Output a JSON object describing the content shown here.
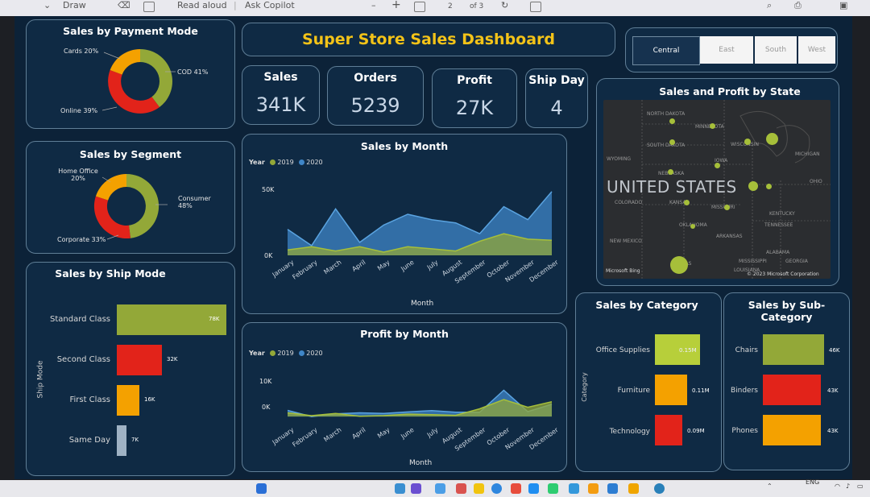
{
  "browser": {
    "draw_label": "Draw",
    "read_aloud_label": "Read aloud",
    "ask_copilot_label": "Ask Copilot",
    "page_current": "2",
    "page_of": "of 3"
  },
  "dashboard": {
    "title": "Super Store Sales Dashboard",
    "slicer": [
      "Central",
      "East",
      "South",
      "West"
    ],
    "kpis": [
      {
        "label": "Sales",
        "value": "341K"
      },
      {
        "label": "Orders",
        "value": "5239"
      },
      {
        "label": "Profit",
        "value": "27K"
      },
      {
        "label": "Ship Day",
        "value": "4"
      }
    ],
    "payment": {
      "title": "Sales by Payment Mode",
      "labels": [
        "Cards 20%",
        "COD 41%",
        "Online 39%"
      ]
    },
    "segment": {
      "title": "Sales by Segment",
      "labels": [
        "Home Office 20%",
        "Consumer 48%",
        "Corporate 33%"
      ]
    },
    "ship_mode": {
      "title": "Sales by Ship Mode",
      "axis": "Ship Mode",
      "items": [
        {
          "label": "Standard Class",
          "value": "78K"
        },
        {
          "label": "Second Class",
          "value": "32K"
        },
        {
          "label": "First Class",
          "value": "16K"
        },
        {
          "label": "Same Day",
          "value": "7K"
        }
      ]
    },
    "sales_month": {
      "title": "Sales by Month",
      "legend_title": "Year",
      "ytick_top": "50K",
      "ytick_bottom": "0K",
      "xlabel": "Month"
    },
    "profit_month": {
      "title": "Profit by Month",
      "legend_title": "Year",
      "ytick_top": "10K",
      "ytick_bottom": "0K",
      "xlabel": "Month"
    },
    "months": [
      "January",
      "February",
      "March",
      "April",
      "May",
      "June",
      "July",
      "August",
      "September",
      "October",
      "November",
      "December"
    ],
    "years": [
      "2019",
      "2020"
    ],
    "map": {
      "title": "Sales and Profit by State",
      "country_label": "UNITED STATES",
      "states": [
        "NORTH DAKOTA",
        "MINNESOTA",
        "WISCONSIN",
        "SOUTH DAKOTA",
        "MICHIGAN",
        "WYOMING",
        "IOWA",
        "NEBRASKA",
        "OHIO",
        "COLORADO",
        "KANSAS",
        "MISSOURI",
        "KENTUCKY",
        "OKLAHOMA",
        "TENNESSEE",
        "NEW MEXICO",
        "ARKANSAS",
        "ALABAMA",
        "TEXAS",
        "MISSISSIPPI",
        "GEORGIA",
        "LOUISIANA"
      ],
      "copyright": "© 2023 Microsoft Corporation",
      "bing_label": "Microsoft Bing"
    },
    "category": {
      "title": "Sales by Category",
      "axis": "Category",
      "items": [
        {
          "label": "Office Supplies",
          "value": "0.15M"
        },
        {
          "label": "Furniture",
          "value": "0.11M"
        },
        {
          "label": "Technology",
          "value": "0.09M"
        }
      ]
    },
    "subcategory": {
      "title": "Sales by Sub-Category",
      "items": [
        {
          "label": "Chairs",
          "value": "46K"
        },
        {
          "label": "Binders",
          "value": "43K"
        },
        {
          "label": "Phones",
          "value": "43K"
        }
      ]
    }
  },
  "taskbar": {
    "language": "ENG"
  },
  "colors": {
    "green": "#93a838",
    "red": "#e2231a",
    "orange": "#f4a100",
    "steel": "#9fb2c4",
    "blue_2020": "#3f86c7",
    "title_yellow": "#f3c318"
  },
  "chart_data": [
    {
      "type": "pie",
      "title": "Sales by Payment Mode",
      "categories": [
        "COD",
        "Online",
        "Cards"
      ],
      "values": [
        41,
        39,
        20
      ]
    },
    {
      "type": "pie",
      "title": "Sales by Segment",
      "categories": [
        "Consumer",
        "Corporate",
        "Home Office"
      ],
      "values": [
        48,
        33,
        20
      ]
    },
    {
      "type": "bar",
      "title": "Sales by Ship Mode",
      "categories": [
        "Standard Class",
        "Second Class",
        "First Class",
        "Same Day"
      ],
      "values": [
        78,
        32,
        16,
        7
      ],
      "ylabel": "Ship Mode"
    },
    {
      "type": "area",
      "title": "Sales by Month",
      "categories": [
        "January",
        "February",
        "March",
        "April",
        "May",
        "June",
        "July",
        "August",
        "September",
        "October",
        "November",
        "December"
      ],
      "xlabel": "Month",
      "ylim": [
        0,
        70
      ],
      "series": [
        {
          "name": "2019",
          "values": [
            5,
            8,
            4,
            8,
            3,
            8,
            6,
            4,
            13,
            20,
            15,
            14
          ]
        },
        {
          "name": "2020",
          "values": [
            24,
            9,
            43,
            12,
            28,
            38,
            33,
            30,
            20,
            45,
            33,
            59
          ]
        }
      ]
    },
    {
      "type": "area",
      "title": "Profit by Month",
      "categories": [
        "January",
        "February",
        "March",
        "April",
        "May",
        "June",
        "July",
        "August",
        "September",
        "October",
        "November",
        "December"
      ],
      "xlabel": "Month",
      "ylim": [
        -1,
        12
      ],
      "series": [
        {
          "name": "2019",
          "values": [
            1.2,
            0.3,
            1.0,
            0.1,
            0.3,
            0.8,
            0.6,
            0.4,
            2.5,
            5.5,
            3.0,
            4.8
          ]
        },
        {
          "name": "2020",
          "values": [
            2.0,
            0.0,
            0.9,
            1.2,
            1.0,
            1.5,
            1.9,
            1.4,
            1.4,
            8.5,
            1.6,
            4.0
          ]
        }
      ]
    },
    {
      "type": "bar",
      "title": "Sales by Category",
      "categories": [
        "Office Supplies",
        "Furniture",
        "Technology"
      ],
      "values": [
        0.15,
        0.11,
        0.09
      ],
      "ylabel": "Category"
    },
    {
      "type": "bar",
      "title": "Sales by Sub-Category",
      "categories": [
        "Chairs",
        "Binders",
        "Phones"
      ],
      "values": [
        46,
        43,
        43
      ]
    }
  ]
}
